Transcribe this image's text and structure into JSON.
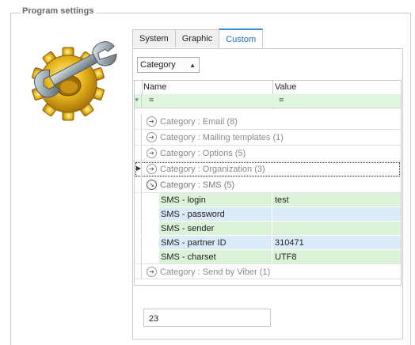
{
  "group_title": "Program settings",
  "tabs": [
    {
      "label": "System",
      "active": false
    },
    {
      "label": "Graphic",
      "active": false
    },
    {
      "label": "Custom",
      "active": true
    }
  ],
  "group_by": {
    "label": "Category",
    "sort": "ascending"
  },
  "grid": {
    "columns": [
      "Name",
      "Value"
    ],
    "filter_row": {
      "name": "=",
      "value": "="
    },
    "groups": [
      {
        "label": "Category : Email (8)",
        "expanded": false
      },
      {
        "label": "Category : Mailing templates (1)",
        "expanded": false
      },
      {
        "label": "Category : Options (5)",
        "expanded": false
      },
      {
        "label": "Category : Organization (3)",
        "expanded": false,
        "focused": true
      },
      {
        "label": "Category : SMS (5)",
        "expanded": true
      },
      {
        "label": "Category : Send by Viber (1)",
        "expanded": false
      }
    ],
    "sms_rows": [
      {
        "name": "SMS - login",
        "value": "test"
      },
      {
        "name": "SMS - password",
        "value": ""
      },
      {
        "name": "SMS - sender",
        "value": ""
      },
      {
        "name": "SMS - partner ID",
        "value": "310471"
      },
      {
        "name": "SMS - charset",
        "value": "UTF8"
      }
    ]
  },
  "record_count": "23",
  "colors": {
    "filter_row": "#dff5dd",
    "odd_row": "#dcf3d9",
    "even_row": "#dbeaf7",
    "active_tab": "#1b73c9"
  }
}
